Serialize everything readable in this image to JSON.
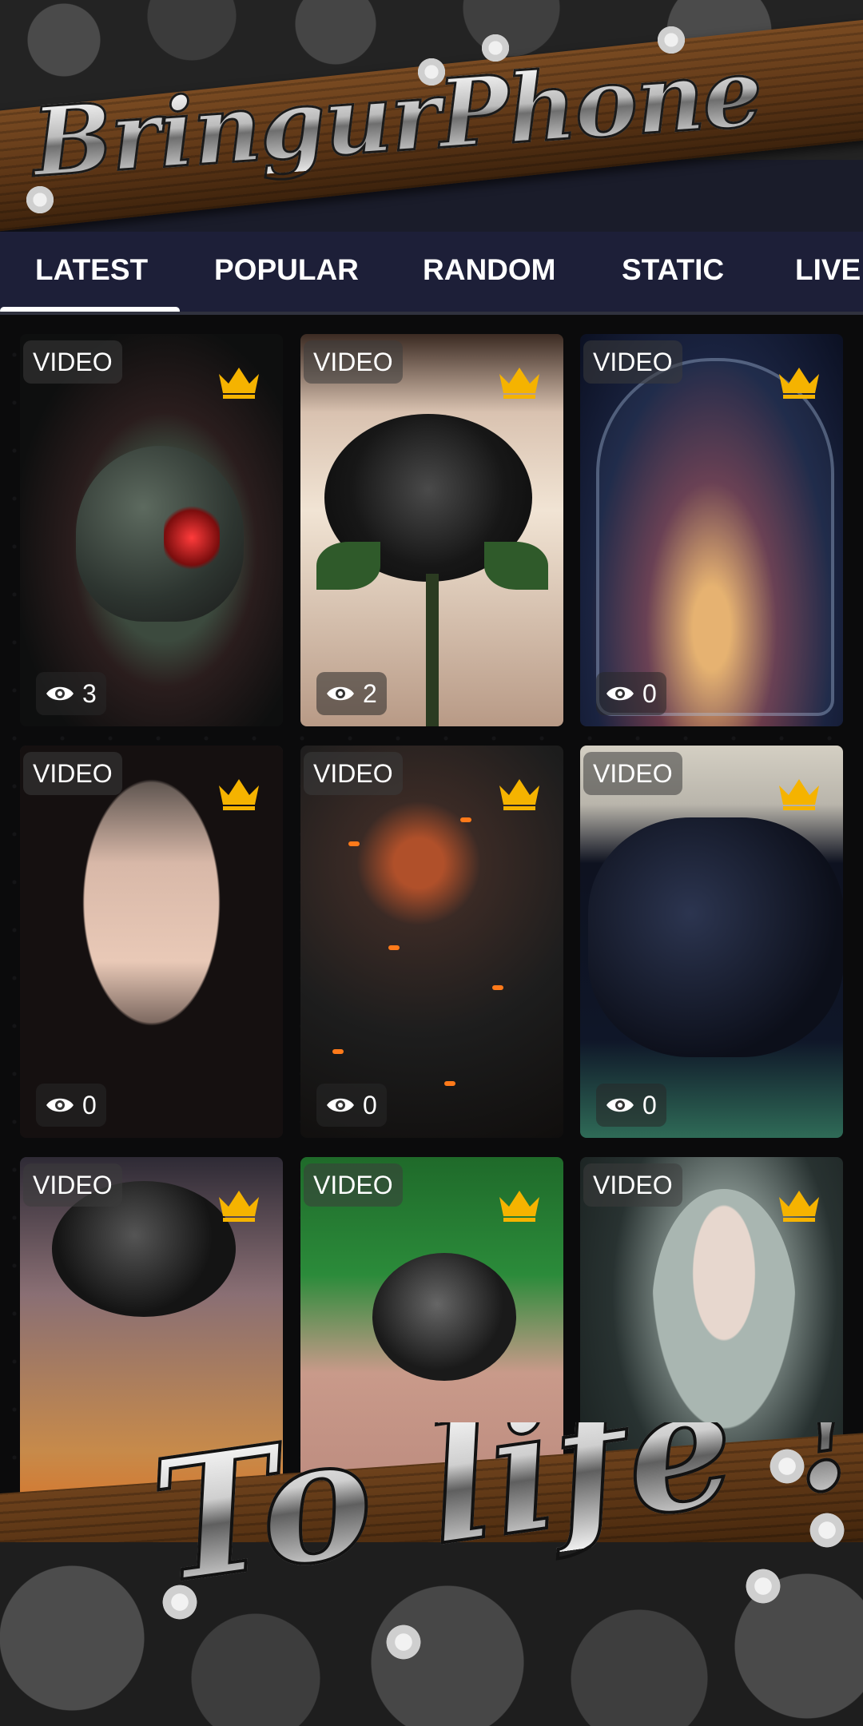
{
  "header": {
    "logo_text": "BringurPhone"
  },
  "tabs": [
    {
      "label": "LATEST",
      "selected": true
    },
    {
      "label": "POPULAR",
      "selected": false
    },
    {
      "label": "RANDOM",
      "selected": false
    },
    {
      "label": "STATIC",
      "selected": false
    },
    {
      "label": "LIVE",
      "selected": false
    }
  ],
  "grid": {
    "items": [
      {
        "badge": "VIDEO",
        "views": "3",
        "premium_icon": "crown-icon",
        "views_icon": "eye-icon"
      },
      {
        "badge": "VIDEO",
        "views": "2",
        "premium_icon": "crown-icon",
        "views_icon": "eye-icon"
      },
      {
        "badge": "VIDEO",
        "views": "0",
        "premium_icon": "crown-icon",
        "views_icon": "eye-icon"
      },
      {
        "badge": "VIDEO",
        "views": "0",
        "premium_icon": "crown-icon",
        "views_icon": "eye-icon"
      },
      {
        "badge": "VIDEO",
        "views": "0",
        "premium_icon": "crown-icon",
        "views_icon": "eye-icon"
      },
      {
        "badge": "VIDEO",
        "views": "0",
        "premium_icon": "crown-icon",
        "views_icon": "eye-icon"
      },
      {
        "badge": "VIDEO",
        "premium_icon": "crown-icon"
      },
      {
        "badge": "VIDEO",
        "premium_icon": "crown-icon"
      },
      {
        "badge": "VIDEO",
        "premium_icon": "crown-icon"
      }
    ]
  },
  "footer": {
    "tagline": "To life !"
  },
  "colors": {
    "tab_bar": "#1d1f38",
    "crown": "#f5b300",
    "background": "#0b0b0c"
  }
}
